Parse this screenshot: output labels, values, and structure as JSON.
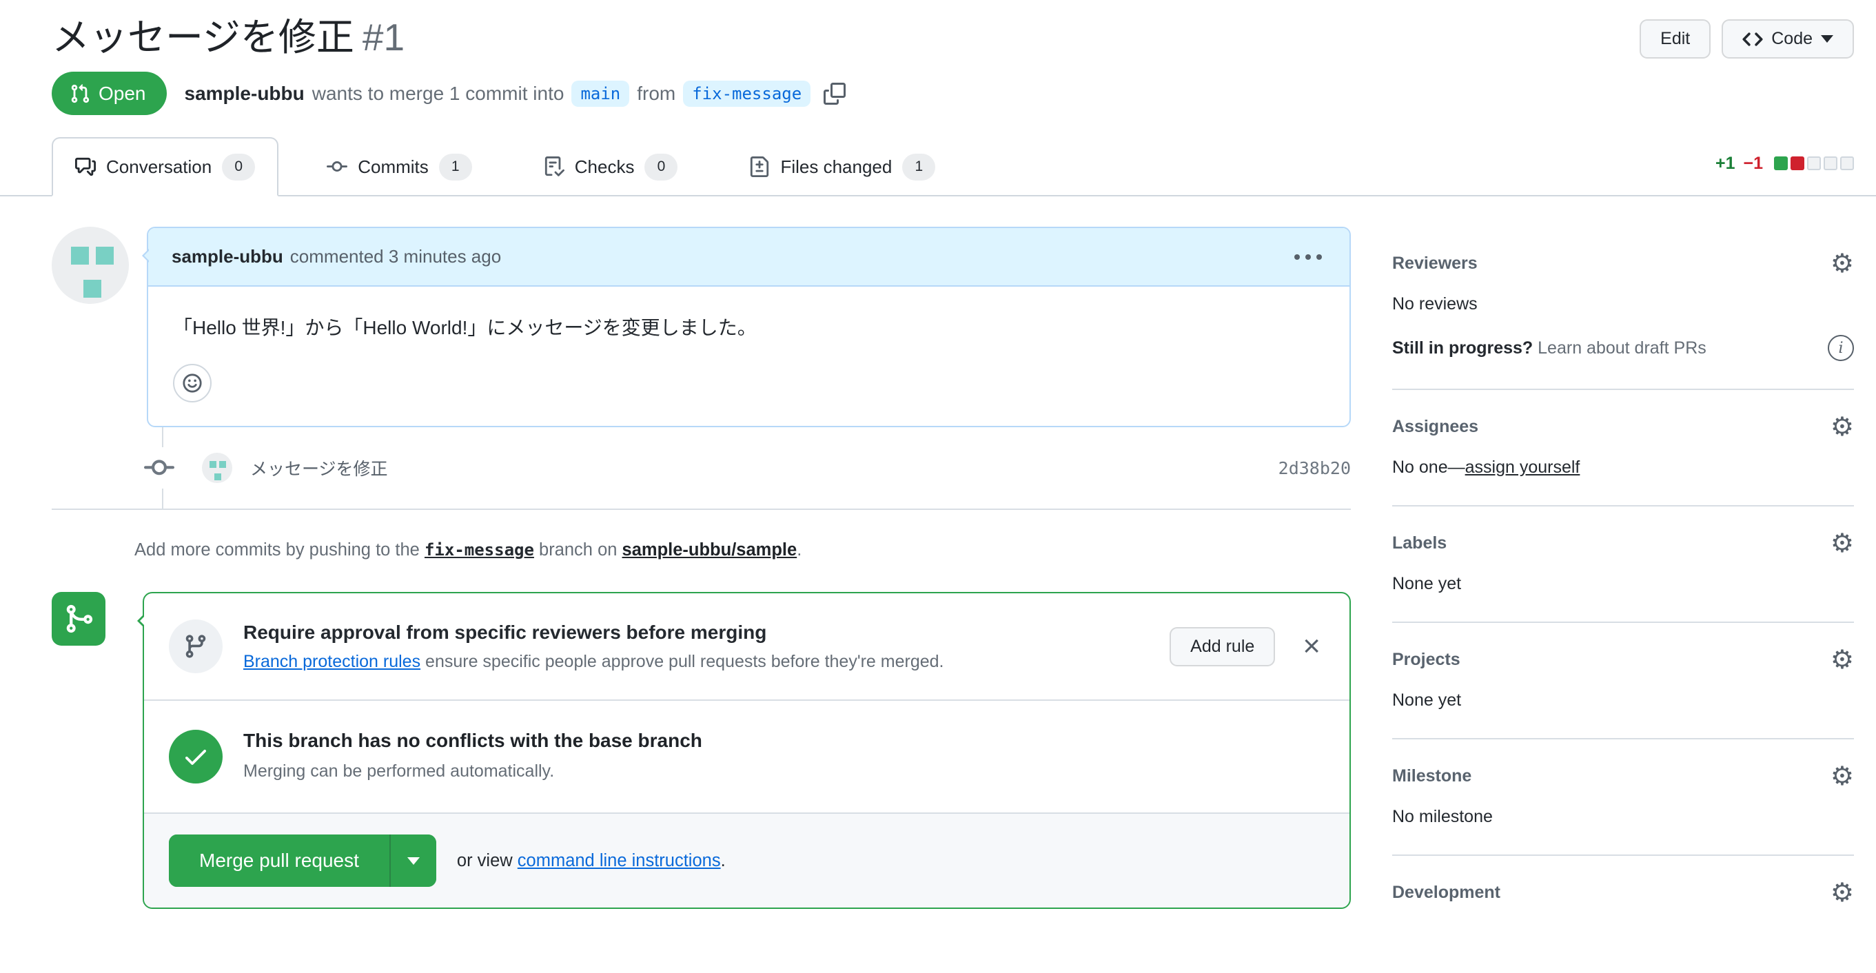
{
  "header": {
    "title": "メッセージを修正",
    "number": "#1",
    "edit_label": "Edit",
    "code_label": "Code",
    "state_label": "Open",
    "author": "sample-ubbu",
    "merge_text_1": "wants to merge 1 commit into",
    "base_branch": "main",
    "merge_text_2": "from",
    "head_branch": "fix-message"
  },
  "tabs": [
    {
      "label": "Conversation",
      "count": "0"
    },
    {
      "label": "Commits",
      "count": "1"
    },
    {
      "label": "Checks",
      "count": "0"
    },
    {
      "label": "Files changed",
      "count": "1"
    }
  ],
  "diffstat": {
    "additions": "+1",
    "deletions": "−1"
  },
  "comment": {
    "author": "sample-ubbu",
    "meta": "commented 3 minutes ago",
    "body": "「Hello 世界!」から「Hello World!」にメッセージを変更しました。"
  },
  "commit": {
    "message": "メッセージを修正",
    "sha": "2d38b20"
  },
  "add_commits": {
    "text_1": "Add more commits by pushing to the",
    "branch": "fix-message",
    "text_2": "branch on",
    "repo": "sample-ubbu/sample",
    "period": "."
  },
  "merge_box": {
    "rule_title": "Require approval from specific reviewers before merging",
    "rule_link": "Branch protection rules",
    "rule_desc": "ensure specific people approve pull requests before they're merged.",
    "add_rule_label": "Add rule",
    "close_label": "×",
    "conflict_title": "This branch has no conflicts with the base branch",
    "conflict_desc": "Merging can be performed automatically.",
    "merge_button": "Merge pull request",
    "or_view": "or view",
    "cli_link": "command line instructions",
    "period": "."
  },
  "sidebar": {
    "reviewers": {
      "heading": "Reviewers",
      "empty": "No reviews",
      "draft_q": "Still in progress?",
      "draft_link": "Learn about draft PRs"
    },
    "assignees": {
      "heading": "Assignees",
      "empty": "No one—",
      "self_link": "assign yourself"
    },
    "labels": {
      "heading": "Labels",
      "empty": "None yet"
    },
    "projects": {
      "heading": "Projects",
      "empty": "None yet"
    },
    "milestone": {
      "heading": "Milestone",
      "empty": "No milestone"
    },
    "development": {
      "heading": "Development"
    }
  },
  "colors": {
    "open_green": "#2da44e",
    "addition_green": "#1a7f37",
    "deletion_red": "#cf222e",
    "link_blue": "#0969da",
    "branch_label_bg": "#ddf4ff",
    "comment_header_bg": "#ddf4ff",
    "identicon_teal": "#79d0c4"
  }
}
